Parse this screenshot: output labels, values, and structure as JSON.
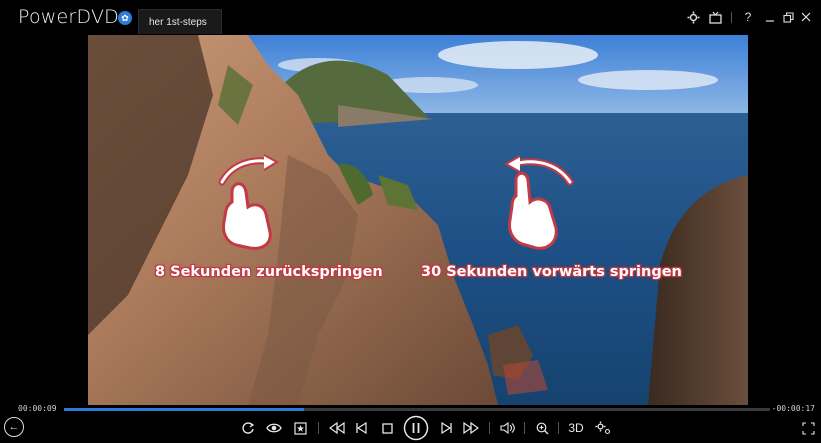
{
  "app": {
    "title": "PowerDVD",
    "tab_title": "her 1st-steps"
  },
  "overlay": {
    "left_caption": "8 Sekunden zurückspringen",
    "right_caption": "30 Sekunden vorwärts springen"
  },
  "playback": {
    "elapsed": "00:00:09",
    "remaining": "-00:00:17",
    "progress_fraction": 0.34
  },
  "controls": {
    "three_d_label": "3D"
  },
  "colors": {
    "accent": "#2f7bd9",
    "caption_glow": "#c23a45"
  }
}
